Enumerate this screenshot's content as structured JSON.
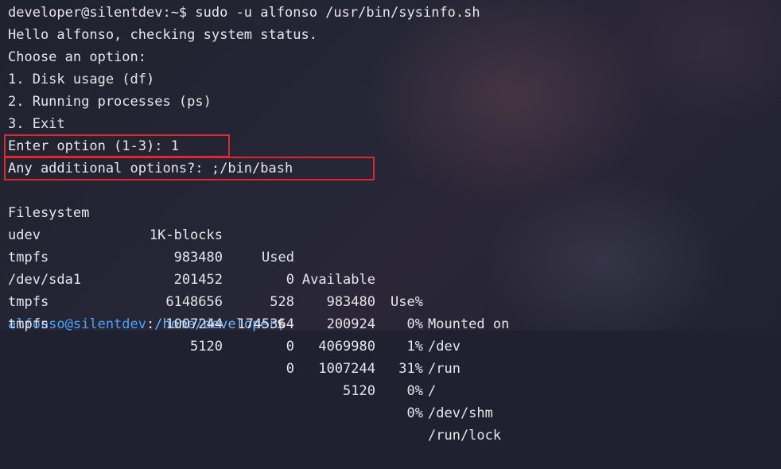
{
  "terminal": {
    "lines": {
      "command": "developer@silentdev:~$ sudo -u alfonso /usr/bin/sysinfo.sh",
      "hello": "Hello alfonso, checking system status.",
      "choose": "Choose an option:",
      "opt1": "1. Disk usage (df)",
      "opt2": "2. Running processes (ps)",
      "opt3": "3. Exit",
      "enter_option": "Enter option (1-3): 1",
      "additional": "Any additional options?: ;/bin/bash"
    },
    "df": {
      "headers": {
        "filesystem": "Filesystem",
        "blocks": "1K-blocks",
        "used": "Used",
        "available": "Available",
        "usepct": "Use%",
        "mounted": "Mounted on"
      },
      "rows": [
        {
          "filesystem": "udev",
          "blocks": "983480",
          "used": "0",
          "available": "983480",
          "usepct": "0%",
          "mounted": "/dev"
        },
        {
          "filesystem": "tmpfs",
          "blocks": "201452",
          "used": "528",
          "available": "200924",
          "usepct": "1%",
          "mounted": "/run"
        },
        {
          "filesystem": "/dev/sda1",
          "blocks": "6148656",
          "used": "1745364",
          "available": "4069980",
          "usepct": "31%",
          "mounted": "/"
        },
        {
          "filesystem": "tmpfs",
          "blocks": "1007244",
          "used": "0",
          "available": "1007244",
          "usepct": "0%",
          "mounted": "/dev/shm"
        },
        {
          "filesystem": "tmpfs",
          "blocks": "5120",
          "used": "0",
          "available": "5120",
          "usepct": "0%",
          "mounted": "/run/lock"
        }
      ]
    },
    "prompt": {
      "user_host": "alfonso@silentdev",
      "colon": ":",
      "path": "/home/developer",
      "dollar": "$"
    }
  },
  "colors": {
    "highlight": "#e0262f",
    "text": "#e6e6ec",
    "prompt_user": "#4aa3ff"
  }
}
